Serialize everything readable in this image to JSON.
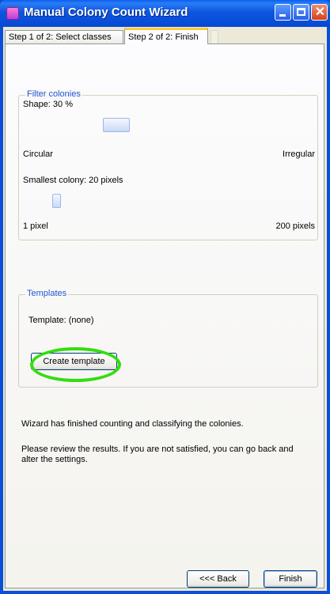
{
  "window": {
    "title": "Manual Colony Count Wizard",
    "icon": "app-icon",
    "controls": [
      "minimize-icon",
      "maximize-icon",
      "close-icon"
    ]
  },
  "tabs": [
    {
      "label": "Step 1 of 2: Select classes",
      "selected": false
    },
    {
      "label": "Step 2 of 2: Finish",
      "selected": true
    }
  ],
  "filter": {
    "legend": "Filter colonies",
    "shape_label": "Shape: 30 %",
    "shape_value_percent": 30,
    "shape_min_label": "Circular",
    "shape_max_label": "Irregular",
    "size_label": "Smallest colony: 20 pixels",
    "size_value": 20,
    "size_min_label": "1 pixel",
    "size_max_label": "200 pixels"
  },
  "templates": {
    "legend": "Templates",
    "template_label": "Template: (none)",
    "create_button": "Create template"
  },
  "messages": {
    "finished": "Wizard has finished counting and classifying the colonies.",
    "review": "Please review the results. If you are not satisfied, you can go back and alter the settings."
  },
  "footer": {
    "back_button": "<<< Back",
    "finish_button": "Finish"
  },
  "colors": {
    "titlebar": "#0549d3",
    "legend_text": "#2155d5",
    "highlight_ring": "#33dd10"
  }
}
